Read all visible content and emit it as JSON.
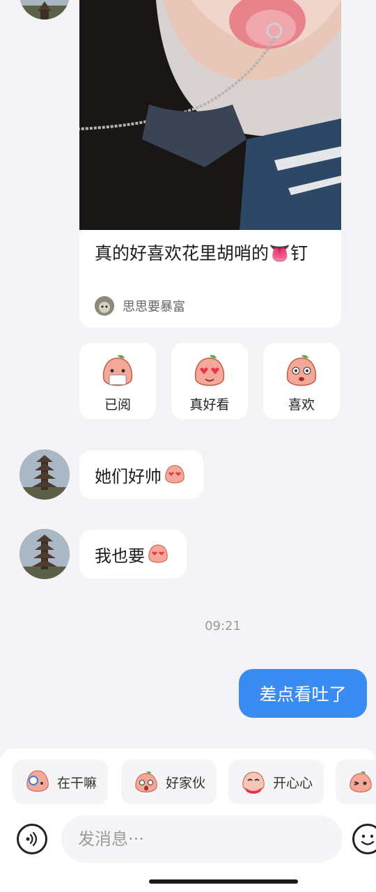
{
  "shared_post": {
    "title": "真的好喜欢花里胡哨的👅钉",
    "author": "思思要暴富"
  },
  "reactions": [
    {
      "label": "已阅",
      "icon": "peach-reading-icon"
    },
    {
      "label": "真好看",
      "icon": "peach-heart-eyes-icon"
    },
    {
      "label": "喜欢",
      "icon": "peach-starry-eyes-icon"
    }
  ],
  "messages": [
    {
      "text": "她们好帅",
      "icon": "heart-eyes-peach-icon"
    },
    {
      "text": "我也要",
      "icon": "heart-eyes-peach-icon"
    }
  ],
  "timestamp": "09:21",
  "outgoing_message": "差点看吐了",
  "quick_replies": [
    {
      "label": "在干嘛",
      "icon": "peach-peek-icon"
    },
    {
      "label": "好家伙",
      "icon": "peach-shocked-icon"
    },
    {
      "label": "开心心",
      "icon": "peach-happy-icon"
    },
    {
      "label": "",
      "icon": "peach-wink-icon"
    }
  ],
  "input": {
    "placeholder": "发消息···"
  },
  "colors": {
    "accent": "#3b8cf2",
    "background": "#f4f4f6"
  }
}
